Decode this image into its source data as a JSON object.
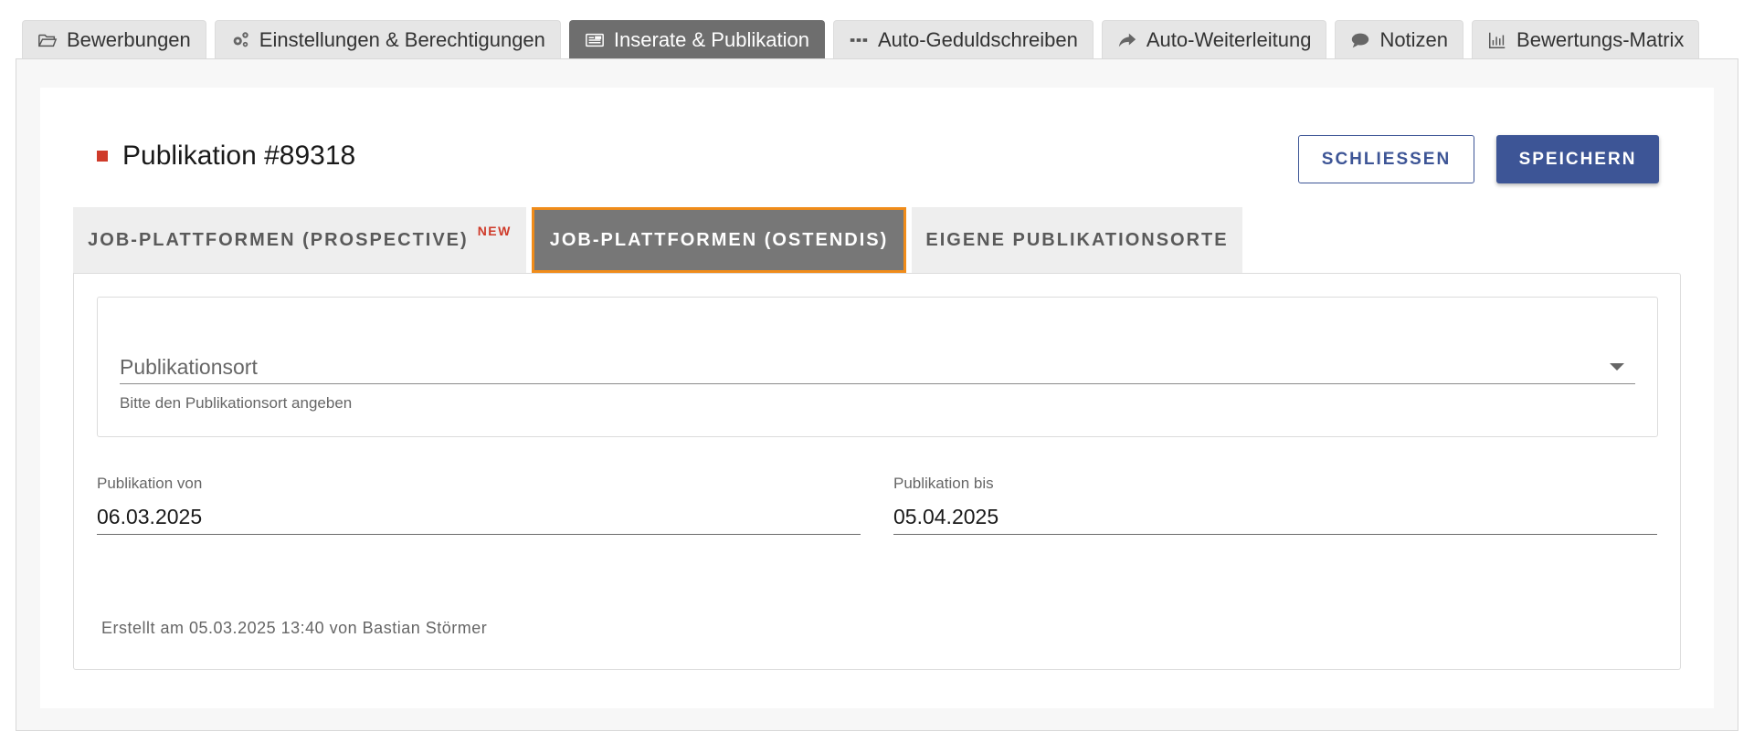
{
  "top_tabs": [
    {
      "label": "Bewerbungen",
      "icon": "folder-open-icon"
    },
    {
      "label": "Einstellungen & Berechtigungen",
      "icon": "gears-icon"
    },
    {
      "label": "Inserate & Publikation",
      "icon": "newspaper-icon",
      "active": true
    },
    {
      "label": "Auto-Geduldschreiben",
      "icon": "ellipsis-icon"
    },
    {
      "label": "Auto-Weiterleitung",
      "icon": "share-arrow-icon"
    },
    {
      "label": "Notizen",
      "icon": "speech-bubble-icon"
    },
    {
      "label": "Bewertungs-Matrix",
      "icon": "bar-chart-icon"
    }
  ],
  "header": {
    "title": "Publikation #89318",
    "close_label": "SCHLIESSEN",
    "save_label": "SPEICHERN"
  },
  "sub_tabs": [
    {
      "label": "JOB-PLATTFORMEN (PROSPECTIVE)",
      "badge": "NEW"
    },
    {
      "label": "JOB-PLATTFORMEN (OSTENDIS)",
      "active": true
    },
    {
      "label": "EIGENE PUBLIKATIONSORTE"
    }
  ],
  "form": {
    "publication_place": {
      "label": "Publikationsort",
      "help": "Bitte den Publikationsort angeben"
    },
    "from": {
      "label": "Publikation von",
      "value": "06.03.2025"
    },
    "to": {
      "label": "Publikation bis",
      "value": "05.04.2025"
    }
  },
  "footer": {
    "created": "Erstellt am 05.03.2025 13:40 von Bastian Störmer"
  },
  "colors": {
    "primary": "#3d5596",
    "accent_red": "#cf3b2a",
    "focus_orange": "#f08c1a",
    "active_tab": "#6e6e6e"
  }
}
